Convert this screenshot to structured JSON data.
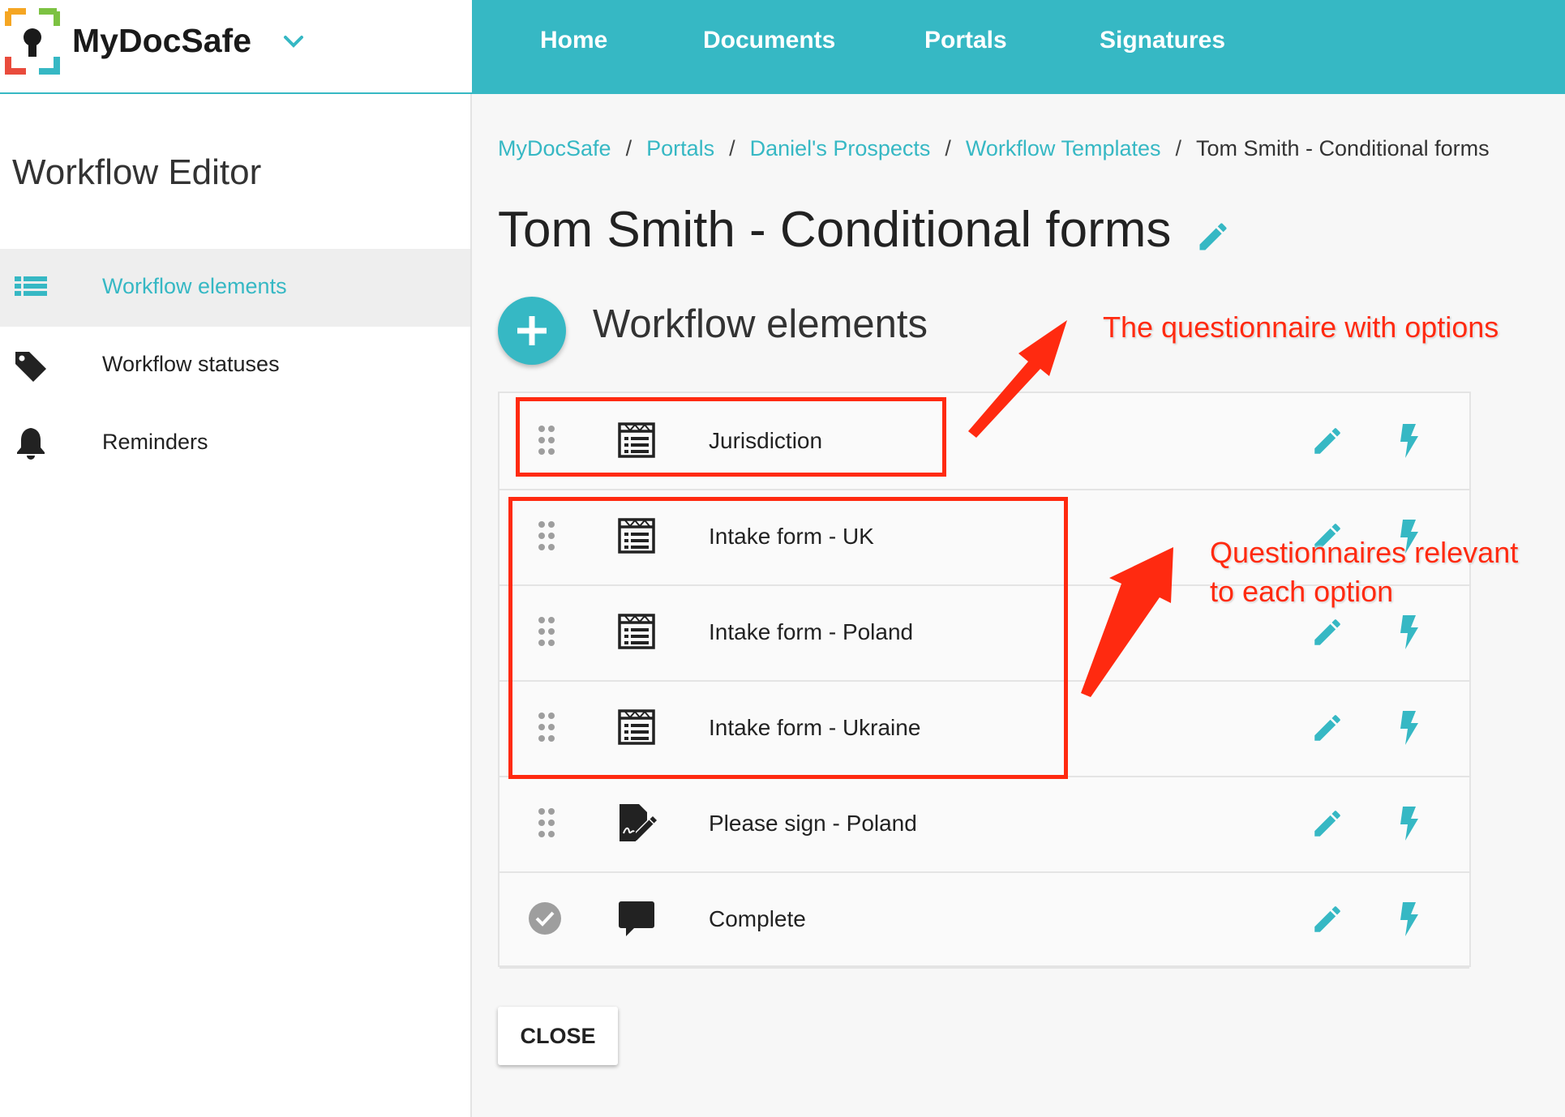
{
  "app": {
    "name": "MyDocSafe"
  },
  "topnav": {
    "items": [
      "Home",
      "Documents",
      "Portals",
      "Signatures"
    ]
  },
  "sidebar": {
    "title": "Workflow Editor",
    "items": [
      {
        "label": "Workflow elements",
        "icon": "list-icon",
        "active": true
      },
      {
        "label": "Workflow statuses",
        "icon": "tag-icon",
        "active": false
      },
      {
        "label": "Reminders",
        "icon": "bell-icon",
        "active": false
      }
    ]
  },
  "breadcrumb": {
    "items": [
      "MyDocSafe",
      "Portals",
      "Daniel's Prospects",
      "Workflow Templates"
    ],
    "current": "Tom Smith - Conditional forms",
    "separator": "/"
  },
  "page": {
    "title": "Tom Smith - Conditional forms",
    "section_title": "Workflow elements"
  },
  "elements": [
    {
      "label": "Jurisdiction",
      "type_icon": "form-icon",
      "status": "draggable"
    },
    {
      "label": "Intake form - UK",
      "type_icon": "form-icon",
      "status": "draggable"
    },
    {
      "label": "Intake form - Poland",
      "type_icon": "form-icon",
      "status": "draggable"
    },
    {
      "label": "Intake form - Ukraine",
      "type_icon": "form-icon",
      "status": "draggable"
    },
    {
      "label": "Please sign - Poland",
      "type_icon": "signature-icon",
      "status": "draggable"
    },
    {
      "label": "Complete",
      "type_icon": "comment-icon",
      "status": "completed"
    }
  ],
  "close_label": "CLOSE",
  "annotations": {
    "top": "The questionnaire with options",
    "middle_line1": "Questionnaires relevant",
    "middle_line2": "to each option"
  },
  "colors": {
    "accent": "#36b8c4",
    "annotation": "#ff2a10",
    "icon_dark": "#222222"
  }
}
